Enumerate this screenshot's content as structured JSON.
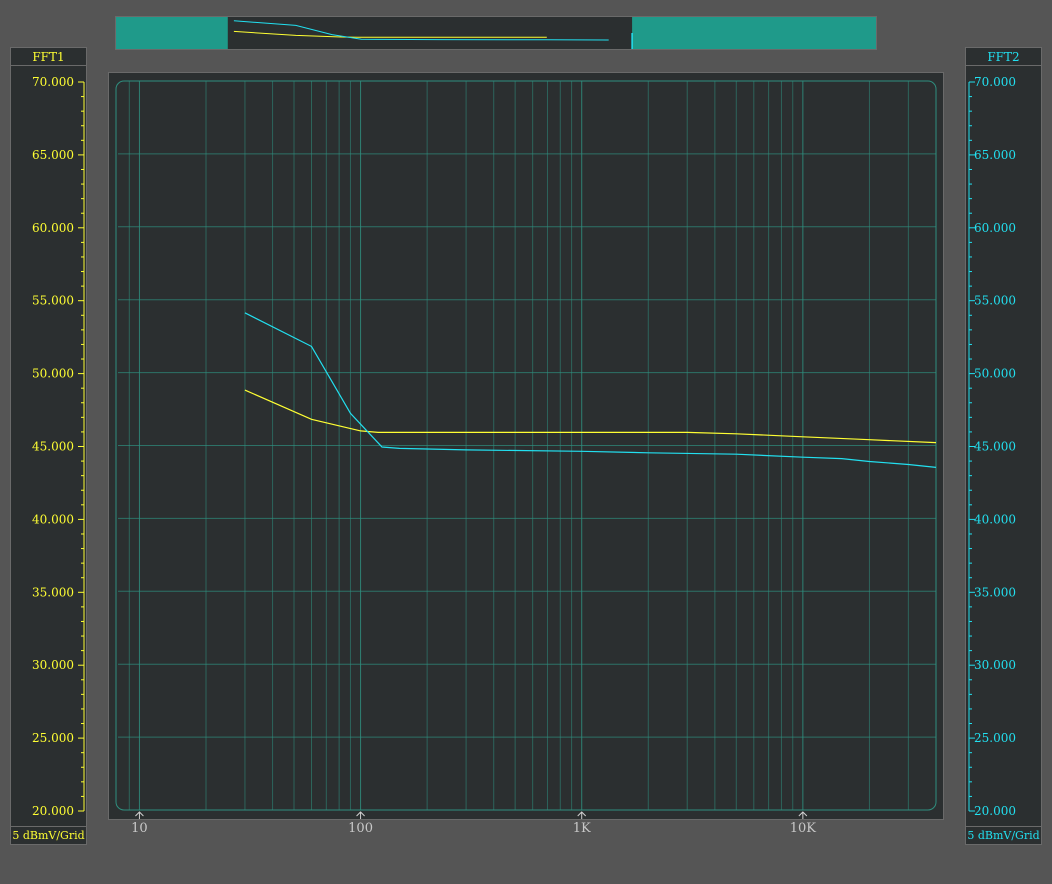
{
  "colors": {
    "background": "#555555",
    "panel": "#2b2f30",
    "grid": "#2f8f7f",
    "trace1": "#ffff33",
    "trace2": "#22e0f0",
    "xTickLabel": "#c8c8c8",
    "overviewFill": "#1f9a8a"
  },
  "left_axis": {
    "title": "FFT1",
    "unit": "5 dBmV/Grid"
  },
  "right_axis": {
    "title": "FFT2",
    "unit": "5 dBmV/Grid"
  },
  "overview": {
    "view_start_hz": 28,
    "view_end_hz": 2600
  },
  "chart_data": {
    "type": "line",
    "title": "",
    "xlabel": "",
    "ylabel": "",
    "xscale": "log",
    "xlim": [
      8,
      40000
    ],
    "ylim": [
      20,
      70
    ],
    "grid": true,
    "x_tick_values": [
      10,
      100,
      1000,
      10000
    ],
    "x_tick_labels": [
      "10",
      "100",
      "1K",
      "10K"
    ],
    "y_tick_values": [
      20,
      25,
      30,
      35,
      40,
      45,
      50,
      55,
      60,
      65,
      70
    ],
    "y_tick_labels": [
      "20.000",
      "25.000",
      "30.000",
      "35.000",
      "40.000",
      "45.000",
      "50.000",
      "55.000",
      "60.000",
      "65.000",
      "70.000"
    ],
    "series": [
      {
        "name": "FFT1",
        "color": "#ffff33",
        "x": [
          30,
          60,
          100,
          120,
          300,
          1000,
          3000,
          5000,
          10000,
          20000,
          40000
        ],
        "y": [
          48.8,
          46.8,
          46.0,
          45.9,
          45.9,
          45.9,
          45.9,
          45.8,
          45.6,
          45.4,
          45.2
        ]
      },
      {
        "name": "FFT2",
        "color": "#22e0f0",
        "x": [
          30,
          60,
          90,
          125,
          150,
          300,
          1000,
          2000,
          5000,
          10000,
          15000,
          20000,
          30000,
          40000
        ],
        "y": [
          54.1,
          51.8,
          47.2,
          44.9,
          44.8,
          44.7,
          44.6,
          44.5,
          44.4,
          44.2,
          44.1,
          43.9,
          43.7,
          43.5
        ]
      }
    ]
  }
}
